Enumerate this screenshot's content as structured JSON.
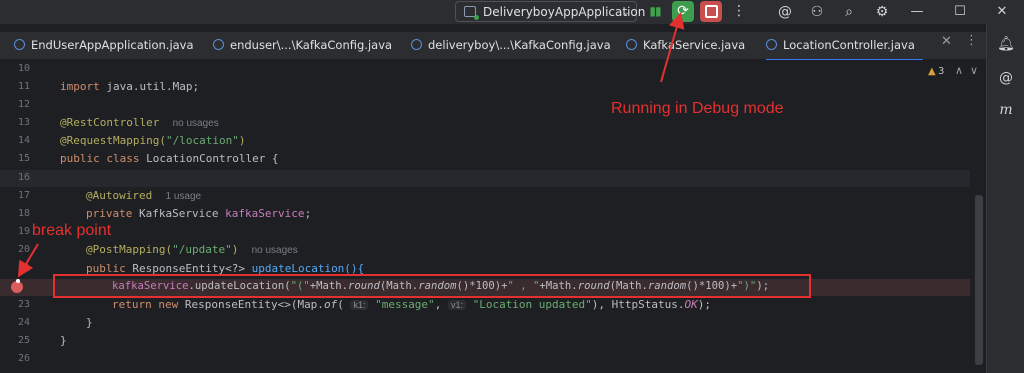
{
  "toolbar": {
    "run_config": "DeliveryboyAppApplication",
    "run_config_chevron": "⌄",
    "pause_icon": "pause-icon",
    "debug_icon": "debug-icon",
    "stop_icon": "stop-icon",
    "more_icon": "⋮",
    "ai_icon": "ai-assistant-icon",
    "add_user_icon": "add-user-icon",
    "search_icon": "search-icon",
    "settings_icon": "gear-icon",
    "minimize": "—",
    "maximize": "☐",
    "close": "✕"
  },
  "tabs": [
    {
      "label": "EndUserAppApplication.java",
      "active": false
    },
    {
      "label": "enduser\\...\\KafkaConfig.java",
      "active": false
    },
    {
      "label": "deliveryboy\\...\\KafkaConfig.java",
      "active": false
    },
    {
      "label": "KafkaService.java",
      "active": false
    },
    {
      "label": "LocationController.java",
      "active": true
    }
  ],
  "tab_close": "✕",
  "tab_more": "⋮",
  "inspection": {
    "count": "3",
    "up": "∧",
    "down": "∨"
  },
  "line_numbers": [
    "10",
    "11",
    "12",
    "13",
    "14",
    "15",
    "16",
    "17",
    "18",
    "19",
    "20",
    "21",
    "22",
    "23",
    "24",
    "25",
    "26"
  ],
  "code": {
    "l11_kw": "import",
    "l11_rest": " java.util.Map;",
    "l13_ann": "@RestController",
    "l13_hint": "no usages",
    "l14_ann": "@RequestMapping(",
    "l14_str": "\"/location\"",
    "l14_end": ")",
    "l15_kw": "public class",
    "l15_rest": " LocationController {",
    "l18_ann": "@Autowired",
    "l18_hint": "1 usage",
    "l19_kw": "private",
    "l19_type": " KafkaService ",
    "l19_fld": "kafkaService",
    "l19_end": ";",
    "l21_ann": "@PostMapping(",
    "l21_str": "\"/update\"",
    "l21_end": ")",
    "l21_hint": "no usages",
    "l22_kw": "public",
    "l22_type": " ResponseEntity<?> ",
    "l22_rest": "updateLocation(){",
    "l23_fld": "kafkaService",
    "l23_a": ".updateLocation(",
    "l23_s1": "\"(\"",
    "l23_b": "+Math.",
    "l23_m1": "round",
    "l23_c": "(Math.",
    "l23_m2": "random",
    "l23_d": "()*100)+",
    "l23_s2": "\" , \"",
    "l23_e": "+Math.",
    "l23_m3": "round",
    "l23_f": "(Math.",
    "l23_m4": "random",
    "l23_g": "()*100)+",
    "l23_s3": "\")\"",
    "l23_h": ");",
    "l24_kw": "return new",
    "l24_a": " ResponseEntity<>(Map.",
    "l24_of": "of",
    "l24_b": "( ",
    "l24_k1": "k1:",
    "l24_s1": " \"message\"",
    "l24_c": ", ",
    "l24_v1": "v1:",
    "l24_s2": " \"Location updated\"",
    "l24_d": "), HttpStatus.",
    "l24_ok": "OK",
    "l24_e": ");",
    "l25": "}",
    "l26": "}"
  },
  "annotations": {
    "debug_label": "Running in Debug mode",
    "breakpoint_label": "break point"
  },
  "right_sidebar": [
    "notifications-icon",
    "ai-chat-icon",
    "m-icon"
  ]
}
